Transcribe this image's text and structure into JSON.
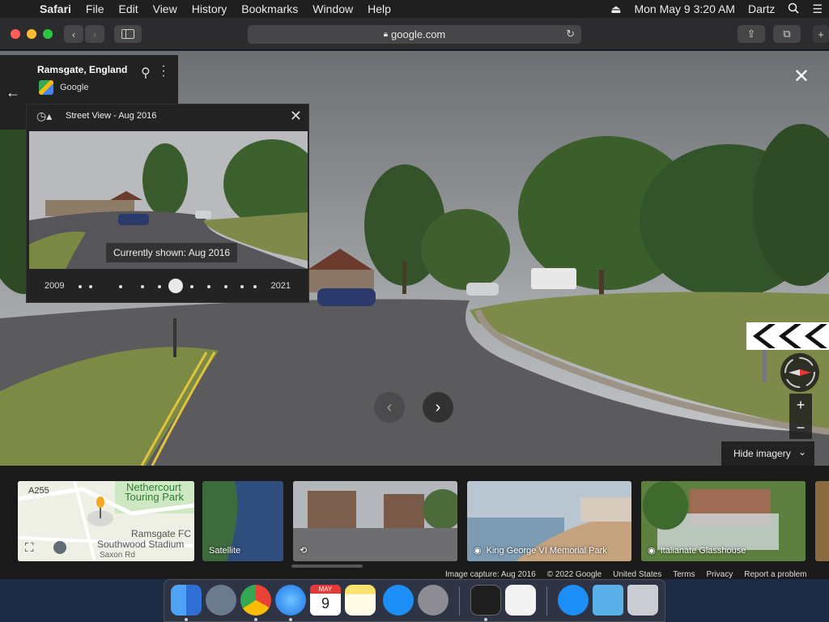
{
  "menubar": {
    "apple_icon": "apple-icon",
    "app_name": "Safari",
    "items": [
      "File",
      "Edit",
      "View",
      "History",
      "Bookmarks",
      "Window",
      "Help"
    ],
    "clock": "Mon May 9  3:20 AM",
    "user": "Dartz"
  },
  "browser": {
    "url": "google.com"
  },
  "place": {
    "title": "Ramsgate, England",
    "provider": "Google"
  },
  "history": {
    "title": "Street View - Aug 2016",
    "tooltip": "Currently shown: Aug 2016",
    "year_start": "2009",
    "year_end": "2021",
    "timeline_fraction": 0.5
  },
  "controls": {
    "hide_imagery": "Hide imagery"
  },
  "thumbnails": [
    {
      "label": "",
      "map_labels": [
        "A255",
        "Nethercourt",
        "Touring Park",
        "Ramsgate FC",
        "Southwood Stadium",
        "Saxon Rd"
      ]
    },
    {
      "label": "Satellite"
    },
    {
      "label": ""
    },
    {
      "label": "King George VI Memorial Park"
    },
    {
      "label": "Italianate Glasshouse"
    }
  ],
  "footer": {
    "capture": "Image capture: Aug 2016",
    "copyright": "© 2022 Google",
    "region": "United States",
    "terms": "Terms",
    "privacy": "Privacy",
    "report": "Report a problem"
  },
  "dock": {
    "apps": [
      "finder-icon",
      "launchpad-icon",
      "chrome-icon",
      "safari-icon",
      "calendar-icon",
      "notes-icon",
      "app-store-icon",
      "system-preferences-icon",
      "terminal-icon",
      "textedit-icon",
      "app-store-icon",
      "downloads-folder-icon",
      "trash-icon"
    ],
    "calendar_month": "MAY",
    "calendar_day": "9"
  }
}
